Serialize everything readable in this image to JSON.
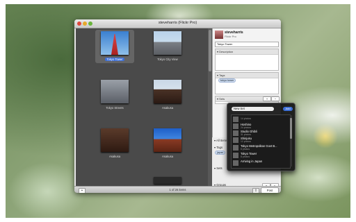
{
  "window": {
    "title": "steveharris (Flickr Pro)"
  },
  "thumbnails": [
    {
      "title": "Tokyo Tower",
      "selected": true
    },
    {
      "title": "Tokyo City View",
      "selected": false
    },
    {
      "title": "Tokyo Streets",
      "selected": false
    },
    {
      "title": "Asakusa",
      "selected": false
    },
    {
      "title": "Asakusa",
      "selected": false
    },
    {
      "title": "Asakusa",
      "selected": false
    }
  ],
  "status": {
    "count": "1 of 26 items"
  },
  "inspector": {
    "user": "steveharris",
    "subtitle": "Flickr Pro",
    "photo_title": "Tokyo Tower",
    "description_label": "Description",
    "tags_label": "Tags",
    "tag": "tokyo tower",
    "sets_label": "Sets",
    "all_items": "All Items",
    "tags_label2": "Tags",
    "tag2": "japan",
    "sets_label2": "Sets",
    "groups_label": "Groups",
    "post_label": "Post"
  },
  "hud": {
    "new_set_value": "New Set",
    "add_label": "Add",
    "sets": [
      {
        "name": "",
        "count": "14 photos"
      },
      {
        "name": "Hoshino",
        "count": "24 photos"
      },
      {
        "name": "Studio Ghibli",
        "count": "31 photos"
      },
      {
        "name": "Shinjuku",
        "count": "12 photos"
      },
      {
        "name": "Tokyo Metropolitan Govt B...",
        "count": "8 photos"
      },
      {
        "name": "Tokyo Tower",
        "count": "8 photos"
      },
      {
        "name": "Arriving in Japan",
        "count": ""
      }
    ]
  },
  "colors": {
    "accent": "#3d6fd6",
    "window_bg": "#4a4a4a"
  }
}
